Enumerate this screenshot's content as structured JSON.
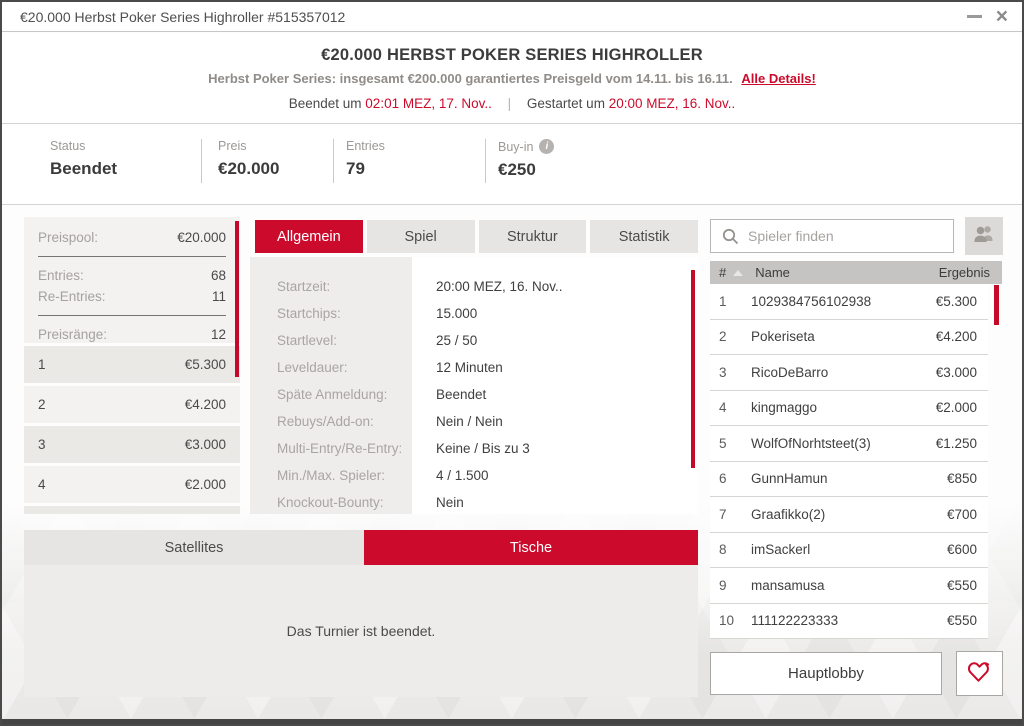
{
  "window": {
    "title": "€20.000 Herbst Poker Series Highroller #515357012"
  },
  "header": {
    "title": "€20.000 HERBST POKER SERIES HIGHROLLER",
    "subtitle": "Herbst Poker Series: insgesamt €200.000 garantiertes Preisgeld vom 14.11. bis 16.11.",
    "details_link": "Alle Details!",
    "ended_label": "Beendet um",
    "ended_time": "02:01 MEZ, 17. Nov..",
    "separator": "|",
    "started_label": "Gestartet um",
    "started_time": "20:00 MEZ, 16. Nov.."
  },
  "stats": [
    {
      "label": "Status",
      "value": "Beendet"
    },
    {
      "label": "Preis",
      "value": "€20.000"
    },
    {
      "label": "Entries",
      "value": "79"
    },
    {
      "label": "Buy-in",
      "value": "€250",
      "info": true
    }
  ],
  "prize_panel": {
    "pool_label": "Preispool:",
    "pool_value": "€20.000",
    "entries_label": "Entries:",
    "entries_value": "68",
    "reentries_label": "Re-Entries:",
    "reentries_value": "11",
    "ranks_label": "Preisränge:",
    "ranks_value": "12",
    "places": [
      {
        "rank": "1",
        "prize": "€5.300"
      },
      {
        "rank": "2",
        "prize": "€4.200"
      },
      {
        "rank": "3",
        "prize": "€3.000"
      },
      {
        "rank": "4",
        "prize": "€2.000"
      }
    ]
  },
  "info_tabs": [
    {
      "label": "Allgemein",
      "active": true
    },
    {
      "label": "Spiel"
    },
    {
      "label": "Struktur"
    },
    {
      "label": "Statistik"
    }
  ],
  "details": [
    {
      "label": "Startzeit:",
      "value": "20:00 MEZ, 16. Nov.."
    },
    {
      "label": "Startchips:",
      "value": "15.000"
    },
    {
      "label": "Startlevel:",
      "value": "25 / 50"
    },
    {
      "label": "Leveldauer:",
      "value": "12 Minuten"
    },
    {
      "label": "Späte Anmeldung:",
      "value": "Beendet"
    },
    {
      "label": "Rebuys/Add-on:",
      "value": "Nein / Nein"
    },
    {
      "label": "Multi-Entry/Re-Entry:",
      "value": "Keine / Bis zu 3"
    },
    {
      "label": "Min./Max. Spieler:",
      "value": "4 / 1.500"
    },
    {
      "label": "Knockout-Bounty:",
      "value": "Nein"
    }
  ],
  "bottom_tabs": {
    "satellites": "Satellites",
    "tische": "Tische"
  },
  "message": "Das Turnier ist beendet.",
  "players": {
    "search_placeholder": "Spieler finden",
    "columns": {
      "rank": "#",
      "name": "Name",
      "result": "Ergebnis"
    },
    "rows": [
      {
        "rank": "1",
        "name": "1029384756102938",
        "result": "€5.300"
      },
      {
        "rank": "2",
        "name": "Pokeriseta",
        "result": "€4.200"
      },
      {
        "rank": "3",
        "name": "RicoDeBarro",
        "result": "€3.000"
      },
      {
        "rank": "4",
        "name": "kingmaggo",
        "result": "€2.000"
      },
      {
        "rank": "5",
        "name": "WolfOfNorhtsteet(3)",
        "result": "€1.250"
      },
      {
        "rank": "6",
        "name": "GunnHamun",
        "result": "€850"
      },
      {
        "rank": "7",
        "name": "Graafikko(2)",
        "result": "€700"
      },
      {
        "rank": "8",
        "name": "imSackerl",
        "result": "€600"
      },
      {
        "rank": "9",
        "name": "mansamusa",
        "result": "€550"
      },
      {
        "rank": "10",
        "name": "111122223333",
        "result": "€550"
      }
    ]
  },
  "footer": {
    "hauptlobby": "Hauptlobby"
  },
  "colors": {
    "accent_red": "#cc0b2c",
    "window_border": "#454545",
    "panel_gray": "#f3f2f0"
  }
}
